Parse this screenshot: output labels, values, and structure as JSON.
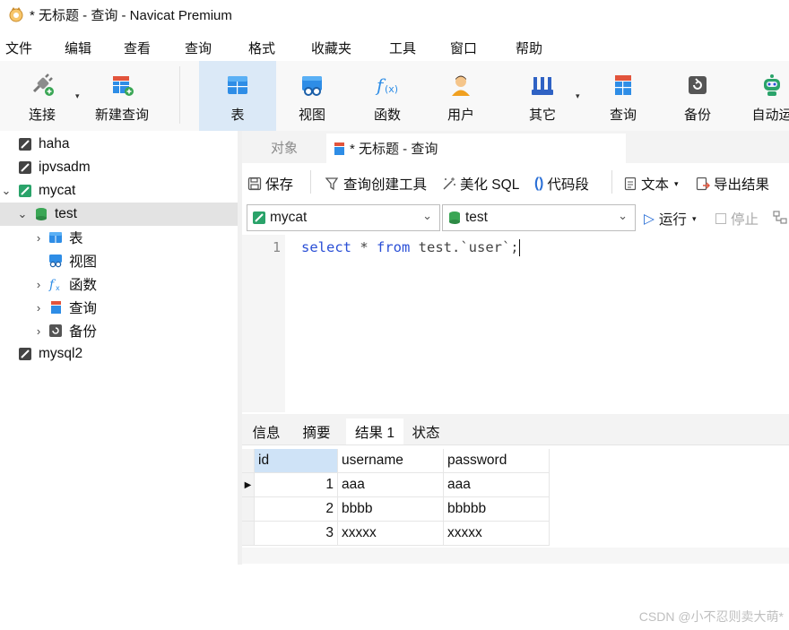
{
  "window": {
    "title": "* 无标题 - 查询 - Navicat Premium"
  },
  "menu": [
    "文件",
    "编辑",
    "查看",
    "查询",
    "格式",
    "收藏夹",
    "工具",
    "窗口",
    "帮助"
  ],
  "toolbar": [
    {
      "id": "connect",
      "label": "连接",
      "icon": "plug-icon",
      "color": "#6b6b6b"
    },
    {
      "id": "new-query",
      "label": "新建查询",
      "icon": "new-query-icon",
      "color": "#e2543c"
    },
    {
      "id": "table",
      "label": "表",
      "icon": "table-icon",
      "color": "#2e8de6",
      "active": true
    },
    {
      "id": "view",
      "label": "视图",
      "icon": "view-icon",
      "color": "#2e8de6"
    },
    {
      "id": "function",
      "label": "函数",
      "icon": "function-icon",
      "color": "#2e8de6"
    },
    {
      "id": "user",
      "label": "用户",
      "icon": "user-icon",
      "color": "#f0a020"
    },
    {
      "id": "others",
      "label": "其它",
      "icon": "tools-icon",
      "color": "#2f62c4"
    },
    {
      "id": "query",
      "label": "查询",
      "icon": "query-icon",
      "color": "#e2543c"
    },
    {
      "id": "backup",
      "label": "备份",
      "icon": "backup-icon",
      "color": "#555555"
    },
    {
      "id": "automation",
      "label": "自动运",
      "icon": "robot-icon",
      "color": "#2aa36a"
    }
  ],
  "sidebar": {
    "items": [
      {
        "label": "haha",
        "level": 0,
        "icon": "connection-icon"
      },
      {
        "label": "ipvsadm",
        "level": 0,
        "icon": "connection-icon"
      },
      {
        "label": "mycat",
        "level": 0,
        "icon": "connection-active-icon",
        "expanded": true
      },
      {
        "label": "test",
        "level": 1,
        "icon": "database-icon",
        "expanded": true,
        "selected": true
      },
      {
        "label": "表",
        "level": 2,
        "icon": "table-icon"
      },
      {
        "label": "视图",
        "level": 2,
        "icon": "view-icon"
      },
      {
        "label": "函数",
        "level": 2,
        "icon": "function-icon"
      },
      {
        "label": "查询",
        "level": 2,
        "icon": "query-icon"
      },
      {
        "label": "备份",
        "level": 2,
        "icon": "backup-icon"
      },
      {
        "label": "mysql2",
        "level": 0,
        "icon": "connection-icon"
      }
    ]
  },
  "tabs": {
    "objects": "对象",
    "query": "* 无标题 - 查询"
  },
  "editor_toolbar": {
    "save": "保存",
    "query_builder": "查询创建工具",
    "beautify": "美化 SQL",
    "snippet": "代码段",
    "text": "文本",
    "export": "导出结果"
  },
  "selectors": {
    "connection": "mycat",
    "database": "test",
    "run": "运行",
    "stop": "停止"
  },
  "editor": {
    "line_number": "1",
    "sql_keyword1": "select",
    "sql_mid": " * ",
    "sql_keyword2": "from",
    "sql_rest": " test.`user`;"
  },
  "result_tabs": [
    "信息",
    "摘要",
    "结果 1",
    "状态"
  ],
  "result": {
    "columns": [
      "id",
      "username",
      "password"
    ],
    "rows": [
      [
        "1",
        "aaa",
        "aaa"
      ],
      [
        "2",
        "bbbb",
        "bbbbb"
      ],
      [
        "3",
        "xxxxx",
        "xxxxx"
      ]
    ]
  },
  "watermark": "CSDN @小不忍则卖大萌*"
}
